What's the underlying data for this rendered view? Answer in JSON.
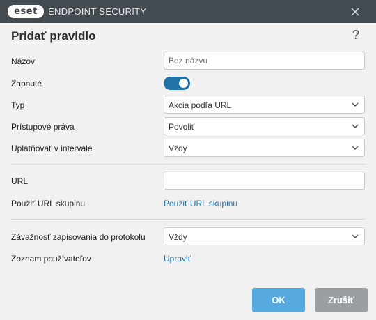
{
  "titlebar": {
    "logo_text": "eset",
    "app_name": "ENDPOINT SECURITY",
    "close_icon": "close-icon"
  },
  "dialog": {
    "title": "Pridať pravidlo",
    "help_glyph": "?"
  },
  "form": {
    "name": {
      "label": "Názov",
      "value": "",
      "placeholder": "Bez názvu"
    },
    "enabled": {
      "label": "Zapnuté",
      "state": true
    },
    "type": {
      "label": "Typ",
      "selected": "Akcia podľa URL"
    },
    "access_rights": {
      "label": "Prístupové práva",
      "selected": "Povoliť"
    },
    "apply_interval": {
      "label": "Uplatňovať v intervale",
      "selected": "Vždy"
    },
    "url": {
      "label": "URL",
      "value": "",
      "placeholder": ""
    },
    "url_group": {
      "label": "Použiť URL skupinu",
      "link": "Použiť URL skupinu"
    },
    "log_severity": {
      "label": "Závažnosť zapisovania do protokolu",
      "selected": "Vždy"
    },
    "user_list": {
      "label": "Zoznam používateľov",
      "link": "Upraviť"
    }
  },
  "buttons": {
    "ok": "OK",
    "cancel": "Zrušiť"
  },
  "colors": {
    "titlebar": "#434a50",
    "accent": "#1f73a7",
    "ok_button": "#56aadf",
    "cancel_button": "#9a9fa3",
    "background": "#f1f1f1"
  }
}
